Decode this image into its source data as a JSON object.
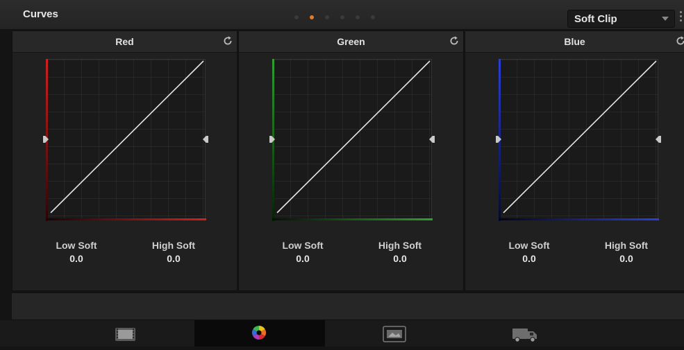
{
  "header": {
    "title": "Curves",
    "mode": "Soft Clip"
  },
  "pager": {
    "count": 6,
    "active": 1
  },
  "panels": [
    {
      "name": "Red",
      "color": "#d22020",
      "low_label": "Low Soft",
      "low_value": "0.0",
      "high_label": "High Soft",
      "high_value": "0.0"
    },
    {
      "name": "Green",
      "color": "#2fa02f",
      "low_label": "Low Soft",
      "low_value": "0.0",
      "high_label": "High Soft",
      "high_value": "0.0"
    },
    {
      "name": "Blue",
      "color": "#2a3fd8",
      "low_label": "Low Soft",
      "low_value": "0.0",
      "high_label": "High Soft",
      "high_value": "0.0"
    }
  ],
  "bottom_nav": [
    {
      "icon": "media-icon",
      "active": false
    },
    {
      "icon": "color-wheel-icon",
      "active": true
    },
    {
      "icon": "gallery-icon",
      "active": false
    },
    {
      "icon": "deliver-icon",
      "active": false
    }
  ]
}
